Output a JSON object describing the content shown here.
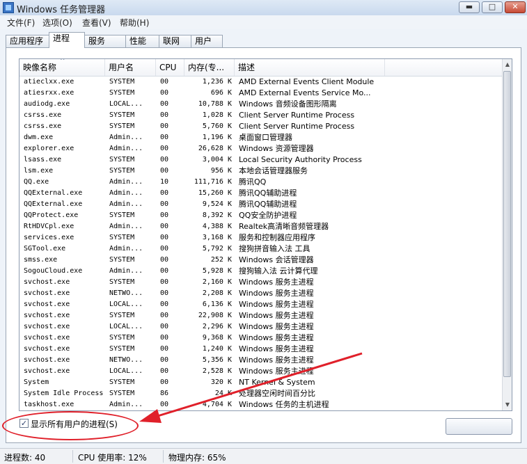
{
  "window": {
    "title": "Windows 任务管理器",
    "min_glyph": "▬",
    "max_glyph": "□",
    "close_glyph": "✕"
  },
  "menu": [
    {
      "label": "文件(F)"
    },
    {
      "label": "选项(O)"
    },
    {
      "label": "查看(V)"
    },
    {
      "label": "帮助(H)"
    }
  ],
  "tabs": [
    {
      "label": "应用程序",
      "active": false
    },
    {
      "label": "进程",
      "active": true
    },
    {
      "label": "服务",
      "active": false
    },
    {
      "label": "性能",
      "active": false
    },
    {
      "label": "联网",
      "active": false
    },
    {
      "label": "用户",
      "active": false
    }
  ],
  "columns": [
    {
      "label": "映像名称"
    },
    {
      "label": "用户名"
    },
    {
      "label": "CPU"
    },
    {
      "label": "内存(专..."
    },
    {
      "label": "描述"
    }
  ],
  "sort_glyph": "^",
  "processes": [
    {
      "name": "atieclxx.exe",
      "user": "SYSTEM",
      "cpu": "00",
      "mem": "1,236 K",
      "desc": "AMD External Events Client Module"
    },
    {
      "name": "atiesrxx.exe",
      "user": "SYSTEM",
      "cpu": "00",
      "mem": "696 K",
      "desc": "AMD External Events Service Mo..."
    },
    {
      "name": "audiodg.exe",
      "user": "LOCAL...",
      "cpu": "00",
      "mem": "10,788 K",
      "desc": "Windows 音频设备图形隔离"
    },
    {
      "name": "csrss.exe",
      "user": "SYSTEM",
      "cpu": "00",
      "mem": "1,028 K",
      "desc": "Client Server Runtime Process"
    },
    {
      "name": "csrss.exe",
      "user": "SYSTEM",
      "cpu": "00",
      "mem": "5,760 K",
      "desc": "Client Server Runtime Process"
    },
    {
      "name": "dwm.exe",
      "user": "Admin...",
      "cpu": "00",
      "mem": "1,196 K",
      "desc": "桌面窗口管理器"
    },
    {
      "name": "explorer.exe",
      "user": "Admin...",
      "cpu": "00",
      "mem": "26,628 K",
      "desc": "Windows 资源管理器"
    },
    {
      "name": "lsass.exe",
      "user": "SYSTEM",
      "cpu": "00",
      "mem": "3,004 K",
      "desc": "Local Security Authority Process"
    },
    {
      "name": "lsm.exe",
      "user": "SYSTEM",
      "cpu": "00",
      "mem": "956 K",
      "desc": "本地会话管理器服务"
    },
    {
      "name": "QQ.exe",
      "user": "Admin...",
      "cpu": "10",
      "mem": "111,716 K",
      "desc": "腾讯QQ"
    },
    {
      "name": "QQExternal.exe",
      "user": "Admin...",
      "cpu": "00",
      "mem": "15,260 K",
      "desc": "腾讯QQ辅助进程"
    },
    {
      "name": "QQExternal.exe",
      "user": "Admin...",
      "cpu": "00",
      "mem": "9,524 K",
      "desc": "腾讯QQ辅助进程"
    },
    {
      "name": "QQProtect.exe",
      "user": "SYSTEM",
      "cpu": "00",
      "mem": "8,392 K",
      "desc": "QQ安全防护进程"
    },
    {
      "name": "RtHDVCpl.exe",
      "user": "Admin...",
      "cpu": "00",
      "mem": "4,388 K",
      "desc": "Realtek高清晰音频管理器"
    },
    {
      "name": "services.exe",
      "user": "SYSTEM",
      "cpu": "00",
      "mem": "3,168 K",
      "desc": "服务和控制器应用程序"
    },
    {
      "name": "SGTool.exe",
      "user": "Admin...",
      "cpu": "00",
      "mem": "5,792 K",
      "desc": "搜狗拼音输入法 工具"
    },
    {
      "name": "smss.exe",
      "user": "SYSTEM",
      "cpu": "00",
      "mem": "252 K",
      "desc": "Windows 会话管理器"
    },
    {
      "name": "SogouCloud.exe",
      "user": "Admin...",
      "cpu": "00",
      "mem": "5,928 K",
      "desc": "搜狗输入法 云计算代理"
    },
    {
      "name": "svchost.exe",
      "user": "SYSTEM",
      "cpu": "00",
      "mem": "2,160 K",
      "desc": "Windows 服务主进程"
    },
    {
      "name": "svchost.exe",
      "user": "NETWO...",
      "cpu": "00",
      "mem": "2,208 K",
      "desc": "Windows 服务主进程"
    },
    {
      "name": "svchost.exe",
      "user": "LOCAL...",
      "cpu": "00",
      "mem": "6,136 K",
      "desc": "Windows 服务主进程"
    },
    {
      "name": "svchost.exe",
      "user": "SYSTEM",
      "cpu": "00",
      "mem": "22,908 K",
      "desc": "Windows 服务主进程"
    },
    {
      "name": "svchost.exe",
      "user": "LOCAL...",
      "cpu": "00",
      "mem": "2,296 K",
      "desc": "Windows 服务主进程"
    },
    {
      "name": "svchost.exe",
      "user": "SYSTEM",
      "cpu": "00",
      "mem": "9,368 K",
      "desc": "Windows 服务主进程"
    },
    {
      "name": "svchost.exe",
      "user": "SYSTEM",
      "cpu": "00",
      "mem": "1,240 K",
      "desc": "Windows 服务主进程"
    },
    {
      "name": "svchost.exe",
      "user": "NETWO...",
      "cpu": "00",
      "mem": "5,356 K",
      "desc": "Windows 服务主进程"
    },
    {
      "name": "svchost.exe",
      "user": "LOCAL...",
      "cpu": "00",
      "mem": "2,528 K",
      "desc": "Windows 服务主进程"
    },
    {
      "name": "System",
      "user": "SYSTEM",
      "cpu": "00",
      "mem": "320 K",
      "desc": "NT Kernel & System"
    },
    {
      "name": "System Idle Process",
      "user": "SYSTEM",
      "cpu": "86",
      "mem": "24 K",
      "desc": "处理器空闲时间百分比"
    },
    {
      "name": "taskhost.exe",
      "user": "Admin...",
      "cpu": "00",
      "mem": "4,704 K",
      "desc": "Windows 任务的主机进程"
    }
  ],
  "show_all_users": {
    "label": "显示所有用户的进程(S)",
    "checked": true,
    "check_glyph": "✓"
  },
  "status": {
    "processes": "进程数: 40",
    "cpu": "CPU 使用率: 12%",
    "memory": "物理内存: 65%"
  },
  "annotation_color": "#e0202a"
}
